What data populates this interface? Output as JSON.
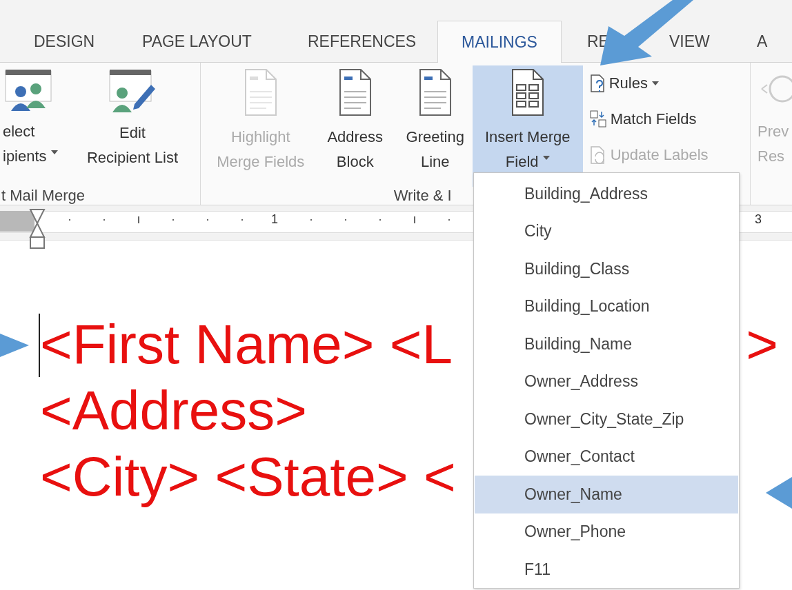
{
  "tabs": [
    {
      "label": "DESIGN",
      "selected": false
    },
    {
      "label": "PAGE LAYOUT",
      "selected": false
    },
    {
      "label": "REFERENCES",
      "selected": false
    },
    {
      "label": "MAILINGS",
      "selected": true
    },
    {
      "label": "RE",
      "selected": false
    },
    {
      "label": "VIEW",
      "selected": false
    },
    {
      "label": "A",
      "selected": false
    }
  ],
  "ribbon": {
    "groups": [
      {
        "label": "t Mail Merge",
        "buttons": [
          {
            "kind": "large",
            "lines": [
              "elect",
              "ipients"
            ],
            "dropdown": true,
            "disabled": false,
            "selected": false
          },
          {
            "kind": "large",
            "lines": [
              "Edit",
              "Recipient List"
            ],
            "dropdown": false,
            "disabled": false,
            "selected": false
          }
        ]
      },
      {
        "label": "Write & I",
        "buttons": [
          {
            "kind": "large",
            "lines": [
              "Highlight",
              "Merge Fields"
            ],
            "dropdown": false,
            "disabled": true,
            "selected": false
          },
          {
            "kind": "large",
            "lines": [
              "Address",
              "Block"
            ],
            "dropdown": false,
            "disabled": false,
            "selected": false
          },
          {
            "kind": "large",
            "lines": [
              "Greeting",
              "Line"
            ],
            "dropdown": false,
            "disabled": false,
            "selected": false
          },
          {
            "kind": "large",
            "lines": [
              "Insert Merge",
              "Field"
            ],
            "dropdown": true,
            "disabled": false,
            "selected": true
          },
          {
            "kind": "small",
            "items": [
              {
                "label": "Rules",
                "dropdown": true,
                "disabled": false
              },
              {
                "label": "Match Fields",
                "dropdown": false,
                "disabled": false
              },
              {
                "label": "Update Labels",
                "dropdown": false,
                "disabled": true
              }
            ]
          }
        ]
      },
      {
        "buttons": [
          {
            "kind": "large",
            "lines": [
              "Prev",
              "Res"
            ],
            "dropdown": false,
            "disabled": true,
            "selected": false
          }
        ]
      }
    ]
  },
  "ruler": {
    "numbers": [
      "1",
      "3"
    ]
  },
  "document": {
    "lines": [
      [
        "<First Name> <L",
        ">"
      ],
      [
        "<Address>"
      ],
      [
        "<City> <State> <"
      ]
    ]
  },
  "menu": {
    "items": [
      {
        "label": "Building_Address",
        "selected": false
      },
      {
        "label": "City",
        "selected": false
      },
      {
        "label": "Building_Class",
        "selected": false
      },
      {
        "label": "Building_Location",
        "selected": false
      },
      {
        "label": "Building_Name",
        "selected": false
      },
      {
        "label": "Owner_Address",
        "selected": false
      },
      {
        "label": "Owner_City_State_Zip",
        "selected": false
      },
      {
        "label": "Owner_Contact",
        "selected": false
      },
      {
        "label": "Owner_Name",
        "selected": true
      },
      {
        "label": "Owner_Phone",
        "selected": false
      },
      {
        "label": "F11",
        "selected": false
      }
    ]
  },
  "callouts": [
    {
      "kind": "down-left"
    },
    {
      "kind": "right"
    },
    {
      "kind": "left"
    }
  ]
}
